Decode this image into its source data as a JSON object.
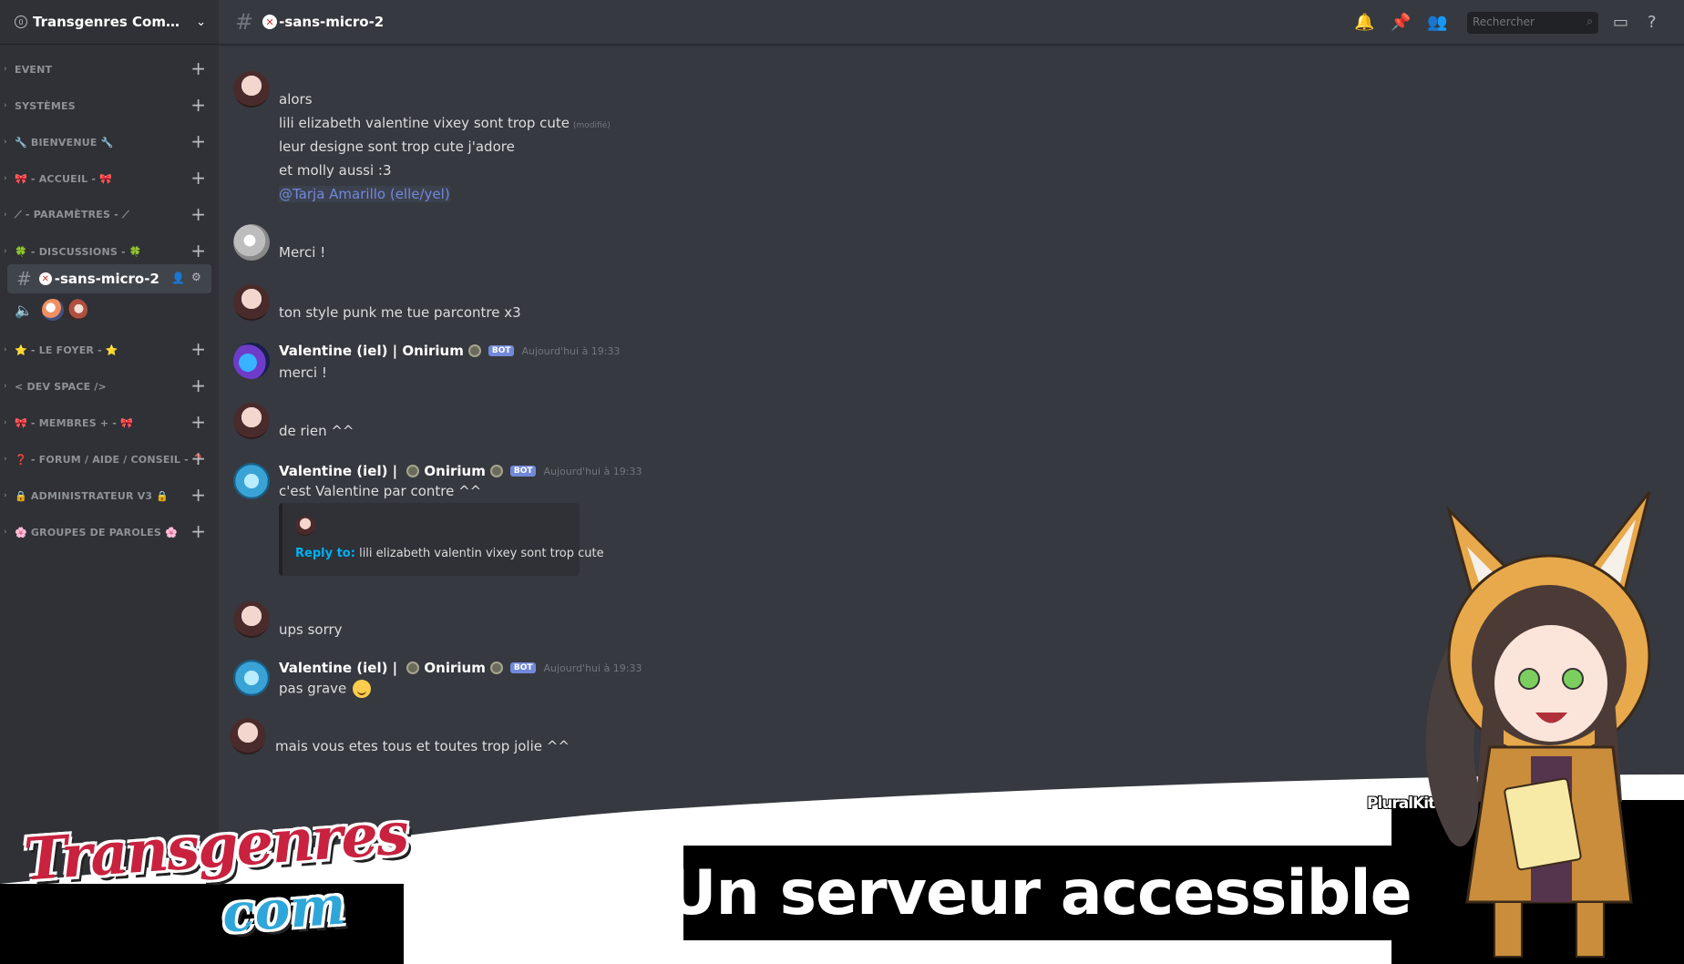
{
  "server": {
    "name": "Transgenres Commun...",
    "boost_label": "0"
  },
  "sidebar": {
    "categories": [
      {
        "label": "EVENT"
      },
      {
        "label": "SYSTÈMES"
      },
      {
        "label": "🔧 BIENVENUE 🔧"
      },
      {
        "label": "🎀 - ACCUEIL - 🎀"
      },
      {
        "label": "⟋ - PARAMÈTRES - ⟋"
      },
      {
        "label": "🍀 - DISCUSSIONS - 🍀"
      },
      {
        "label": "⭐ - LE FOYER - ⭐"
      },
      {
        "label": "< DEV SPACE />"
      },
      {
        "label": "🎀 - MEMBRES + - 🎀"
      },
      {
        "label": "❓ - FORUM / AIDE / CONSEIL - ❓"
      },
      {
        "label": "🔒 ADMINISTRATEUR V3 🔒"
      },
      {
        "label": "🌸 GROUPES DE PAROLES 🌸"
      }
    ],
    "active_channel": {
      "name": "-sans-micro-2"
    }
  },
  "topbar": {
    "channel_name": "-sans-micro-2",
    "search_placeholder": "Rechercher"
  },
  "messages": [
    {
      "lines": [
        "alors",
        "lili elizabeth valentine vixey sont trop cute",
        "leur designe sont trop cute j'adore",
        "et molly aussi :3"
      ],
      "edited": "(modifié)",
      "mention": "@Tarja Amarillo (elle/yel)"
    },
    {
      "text": "Merci !"
    },
    {
      "text": "ton style punk me tue parcontre x3"
    },
    {
      "author": "Valentine (iel) |",
      "author2": "Onirium",
      "bot": "BOT",
      "time": "Aujourd'hui à 19:33",
      "text": "merci !"
    },
    {
      "text": "de rien ^^"
    },
    {
      "author": "Valentine (iel) |",
      "author2": "Onirium",
      "bot": "BOT",
      "time": "Aujourd'hui à 19:33",
      "text": "c'est Valentine par contre ^^",
      "reply": {
        "label": "Reply to:",
        "text": "lili elizabeth valentin vixey sont trop cute"
      }
    },
    {
      "text": "ups sorry"
    },
    {
      "author": "Valentine (iel) |",
      "author2": "Onirium",
      "bot": "BOT",
      "time": "Aujourd'hui à 19:33",
      "text": "pas grave"
    },
    {
      "text": "mais vous etes tous et toutes trop jolie ^^"
    }
  ],
  "banner": {
    "logo_line1": "Transgenres",
    "logo_line2": "com",
    "tagline": "Un serveur accessible",
    "bot_label": "PluralKit Bot"
  },
  "colors": {
    "sidebar": "#2f3136",
    "chat": "#36393f",
    "blurple": "#7289da",
    "logo_red": "#c8223f",
    "logo_blue": "#2ea6d9"
  }
}
